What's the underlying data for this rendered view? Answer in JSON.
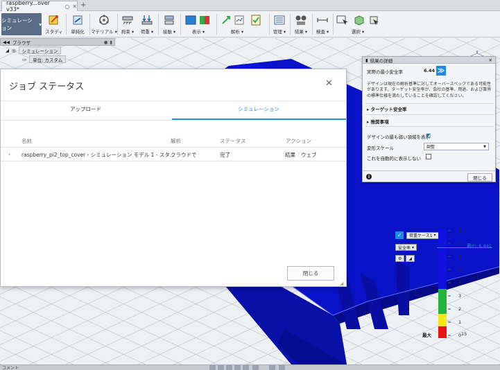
{
  "window": {
    "doc_tab": "raspberry...over v33*"
  },
  "toolbar": {
    "workspace": "シミュレーション",
    "items": [
      {
        "label": "スタディ"
      },
      {
        "label": "単純化"
      },
      {
        "label": "マテリアル"
      },
      {
        "label": "拘束"
      },
      {
        "label": "荷重"
      },
      {
        "label": "接触"
      },
      {
        "label": "表示"
      },
      {
        "label": "解析"
      },
      {
        "label": "管理"
      },
      {
        "label": "結果"
      },
      {
        "label": "検査"
      },
      {
        "label": "選択"
      }
    ]
  },
  "browser": {
    "title": "ブラウザ",
    "root": "シミュレーション",
    "unit": "単位: カスタム"
  },
  "results_panel": {
    "title": "結果の詳細",
    "min_sf_label": "実際の最小安全率",
    "min_sf_value": "6.44",
    "description": "デザインは現在の解析基準に対してオーバースペックである可能性があります。ターゲット安全率が、会社の基準、用途、および業界の標準仕様を満たしていることを確認してください。",
    "target_sf": "ターゲット安全率",
    "recommendations": "推奨事項",
    "show_weakest": "デザインの最も弱い領域を表示",
    "deform_scale_label": "変形スケール",
    "deform_scale_value": "調整",
    "auto_show": "これを自動的に表示しない",
    "close": "閉じる"
  },
  "legend": {
    "load_case": "荷重ケース1",
    "result_type": "安全率",
    "min_label": "最小: 6.441",
    "max_label": "最大",
    "ticks": [
      "8 +",
      "7",
      "6",
      "5",
      "4",
      "3",
      "2",
      "1",
      "0"
    ],
    "max_value": "15",
    "colors": {
      "blue": "#1010e0",
      "green": "#22b43c",
      "yellow": "#f2ea16",
      "red": "#e61414"
    }
  },
  "dialog": {
    "title": "ジョブ ステータス",
    "tabs": [
      {
        "label": "アップロード"
      },
      {
        "label": "シミュレーション"
      }
    ],
    "columns": [
      "名前",
      "解析",
      "ステータス",
      "アクション"
    ],
    "rows": [
      {
        "name": "raspberry_pi2_top_cover - シミュレーション モデル 1 - スタ...",
        "analysis": "クラウドで",
        "status": "完了",
        "action_results": "結果",
        "action_web": "ウェブ"
      }
    ],
    "close": "閉じる"
  },
  "bottom": {
    "comment": "コメント"
  },
  "colors": {
    "accent": "#2d8fd5",
    "model_blue": "#0a12c8",
    "workspace_bg": "#5b6d86"
  }
}
